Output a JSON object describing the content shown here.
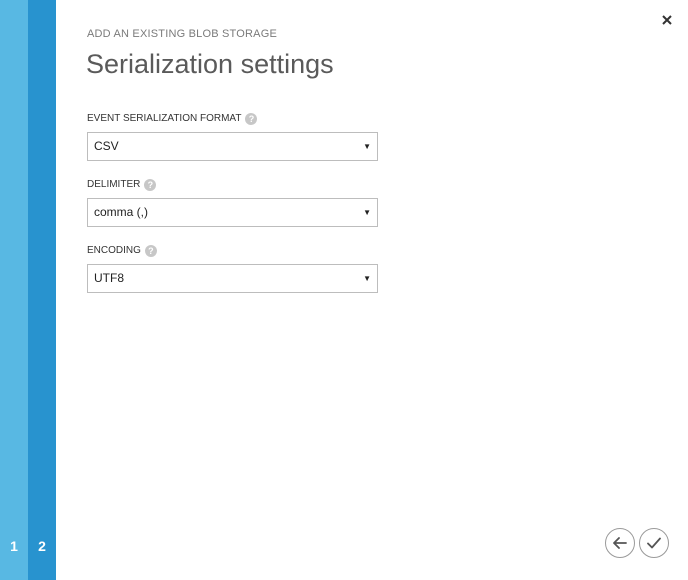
{
  "wizard": {
    "steps": [
      "1",
      "2"
    ],
    "current_step": 2
  },
  "header": {
    "subtitle": "ADD AN EXISTING BLOB STORAGE",
    "title": "Serialization settings"
  },
  "fields": [
    {
      "label": "EVENT SERIALIZATION FORMAT",
      "value": "CSV"
    },
    {
      "label": "DELIMITER",
      "value": "comma (,)"
    },
    {
      "label": "ENCODING",
      "value": "UTF8"
    }
  ],
  "icons": {
    "close": "close-icon",
    "help": "help-icon",
    "dropdown": "dropdown-arrow-icon",
    "back": "arrow-left-icon",
    "complete": "checkmark-icon"
  },
  "colors": {
    "step_1": "#58b8e3",
    "step_2": "#2893cf"
  }
}
